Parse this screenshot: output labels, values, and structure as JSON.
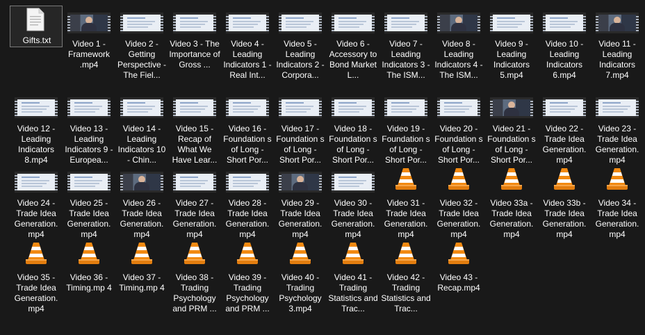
{
  "files": [
    {
      "label": "Gifts.txt",
      "icon": "text-file-icon"
    },
    {
      "label": "Video 1 - Framework .mp4",
      "icon": "video-thumbnail-person"
    },
    {
      "label": "Video 2 - Getting Perspective - The Fiel...",
      "icon": "video-thumbnail-doc"
    },
    {
      "label": "Video 3 - The Importance of Gross ...",
      "icon": "video-thumbnail-doc"
    },
    {
      "label": "Video 4 - Leading Indicators 1 - Real Int...",
      "icon": "video-thumbnail-doc"
    },
    {
      "label": "Video 5 - Leading Indicators 2 - Corpora...",
      "icon": "video-thumbnail-doc"
    },
    {
      "label": "Video 6 - Accessory to Bond Market L...",
      "icon": "video-thumbnail-doc"
    },
    {
      "label": "Video 7 - Leading Indicators 3 - The ISM...",
      "icon": "video-thumbnail-doc"
    },
    {
      "label": "Video 8 - Leading Indicators 4 - The ISM...",
      "icon": "video-thumbnail-person"
    },
    {
      "label": "Video 9 - Leading Indicators 5.mp4",
      "icon": "video-thumbnail-doc"
    },
    {
      "label": "Video 10 - Leading Indicators 6.mp4",
      "icon": "video-thumbnail-doc"
    },
    {
      "label": "Video 11 - Leading Indicators 7.mp4",
      "icon": "video-thumbnail-person"
    },
    {
      "label": "Video 12 - Leading Indicators 8.mp4",
      "icon": "video-thumbnail-doc"
    },
    {
      "label": "Video 13 - Leading Indicators 9 - Europea...",
      "icon": "video-thumbnail-doc"
    },
    {
      "label": "Video 14 - Leading Indicators 10 - Chin...",
      "icon": "video-thumbnail-doc"
    },
    {
      "label": "Video 15 - Recap of What We Have Lear...",
      "icon": "video-thumbnail-doc"
    },
    {
      "label": "Video 16 - Foundation s of Long - Short Por...",
      "icon": "video-thumbnail-doc"
    },
    {
      "label": "Video 17 - Foundation s of Long - Short Por...",
      "icon": "video-thumbnail-doc"
    },
    {
      "label": "Video 18 - Foundation s of Long - Short Por...",
      "icon": "video-thumbnail-doc"
    },
    {
      "label": "Video 19 - Foundation s of Long - Short Por...",
      "icon": "video-thumbnail-doc"
    },
    {
      "label": "Video 20 - Foundation s of Long - Short Por...",
      "icon": "video-thumbnail-doc"
    },
    {
      "label": "Video 21 - Foundation s of Long - Short Por...",
      "icon": "video-thumbnail-person"
    },
    {
      "label": "Video 22 - Trade Idea Generation. mp4",
      "icon": "video-thumbnail-doc"
    },
    {
      "label": "Video 23 - Trade Idea Generation. mp4",
      "icon": "video-thumbnail-doc"
    },
    {
      "label": "Video 24 - Trade Idea Generation. mp4",
      "icon": "video-thumbnail-doc"
    },
    {
      "label": "Video 25 - Trade Idea Generation. mp4",
      "icon": "video-thumbnail-doc"
    },
    {
      "label": "Video 26 - Trade Idea Generation. mp4",
      "icon": "video-thumbnail-person"
    },
    {
      "label": "Video 27 - Trade Idea Generation. mp4",
      "icon": "video-thumbnail-doc"
    },
    {
      "label": "Video 28 - Trade Idea Generation. mp4",
      "icon": "video-thumbnail-doc"
    },
    {
      "label": "Video 29 - Trade Idea Generation. mp4",
      "icon": "video-thumbnail-person"
    },
    {
      "label": "Video 30 - Trade Idea Generation. mp4",
      "icon": "video-thumbnail-doc"
    },
    {
      "label": "Video 31 - Trade Idea Generation. mp4",
      "icon": "vlc-cone-icon"
    },
    {
      "label": "Video 32 - Trade Idea Generation. mp4",
      "icon": "vlc-cone-icon"
    },
    {
      "label": "Video 33a - Trade Idea Generation. mp4",
      "icon": "vlc-cone-icon"
    },
    {
      "label": "Video 33b - Trade Idea Generation. mp4",
      "icon": "vlc-cone-icon"
    },
    {
      "label": "Video 34 - Trade Idea Generation. mp4",
      "icon": "vlc-cone-icon"
    },
    {
      "label": "Video 35 - Trade Idea Generation. mp4",
      "icon": "vlc-cone-icon"
    },
    {
      "label": "Video 36 - Timing.mp 4",
      "icon": "vlc-cone-icon"
    },
    {
      "label": "Video 37 - Timing.mp 4",
      "icon": "vlc-cone-icon"
    },
    {
      "label": "Video 38 - Trading Psychology and PRM ...",
      "icon": "vlc-cone-icon"
    },
    {
      "label": "Video 39 - Trading Psychology and PRM ...",
      "icon": "vlc-cone-icon"
    },
    {
      "label": "Video 40 - Trading Psychology 3.mp4",
      "icon": "vlc-cone-icon"
    },
    {
      "label": "Video 41 - Trading Statistics and Trac...",
      "icon": "vlc-cone-icon"
    },
    {
      "label": "Video 42 - Trading Statistics and Trac...",
      "icon": "vlc-cone-icon"
    },
    {
      "label": "Video 43 - Recap.mp4",
      "icon": "vlc-cone-icon"
    }
  ],
  "colors": {
    "background": "#191919",
    "text": "#ffffff",
    "vlc_orange": "#f28a12",
    "vlc_white": "#ffffff",
    "selection_border": "#7a7a7a"
  }
}
